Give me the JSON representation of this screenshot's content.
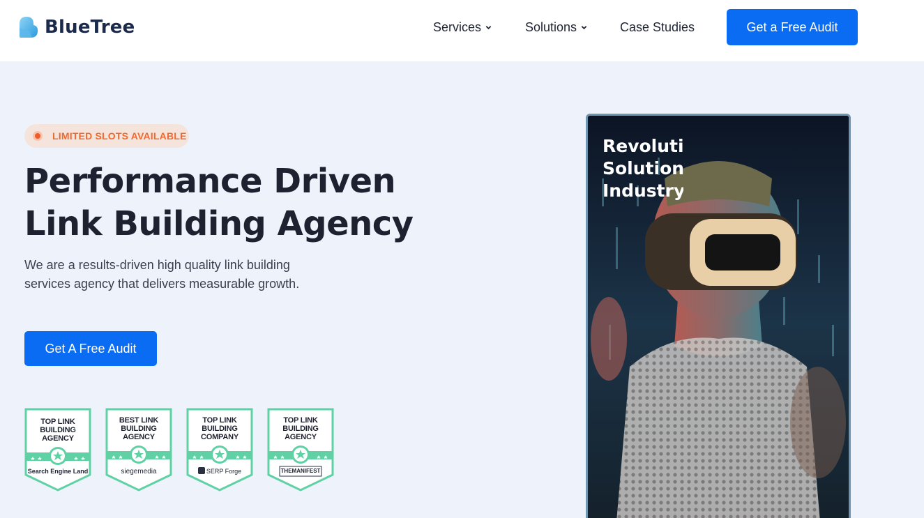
{
  "header": {
    "logo_text": "BlueTree",
    "nav": {
      "services": "Services",
      "solutions": "Solutions",
      "case_studies": "Case Studies"
    },
    "cta": "Get a Free Audit"
  },
  "hero": {
    "badge": "LIMITED SLOTS AVAILABLE",
    "title_line1": "Performance Driven",
    "title_line2": "Link Building Agency",
    "subtitle_line1": "We are a results-driven high quality link building",
    "subtitle_line2": "services agency that delivers measurable growth.",
    "cta": "Get A Free Audit",
    "awards": [
      {
        "title_line1": "TOP LINK",
        "title_line2": "BUILDING",
        "title_line3": "AGENCY",
        "source": "Search Engine Land"
      },
      {
        "title_line1": "BEST LINK",
        "title_line2": "BUILDING",
        "title_line3": "AGENCY",
        "source": "siegemedia"
      },
      {
        "title_line1": "TOP LINK",
        "title_line2": "BUILDING",
        "title_line3": "COMPANY",
        "source": "SERP Forge"
      },
      {
        "title_line1": "TOP LINK",
        "title_line2": "BUILDING",
        "title_line3": "AGENCY",
        "source": "THEMANIFEST"
      }
    ]
  },
  "video": {
    "caption_line1": "Revolutionary",
    "caption_line2": "Solutions",
    "caption_line3": "Industry"
  },
  "colors": {
    "brand_blue": "#0a6cf2",
    "badge_orange": "#ef6a2f",
    "award_green": "#5fd1a4",
    "hero_bg": "#eef3fb"
  }
}
